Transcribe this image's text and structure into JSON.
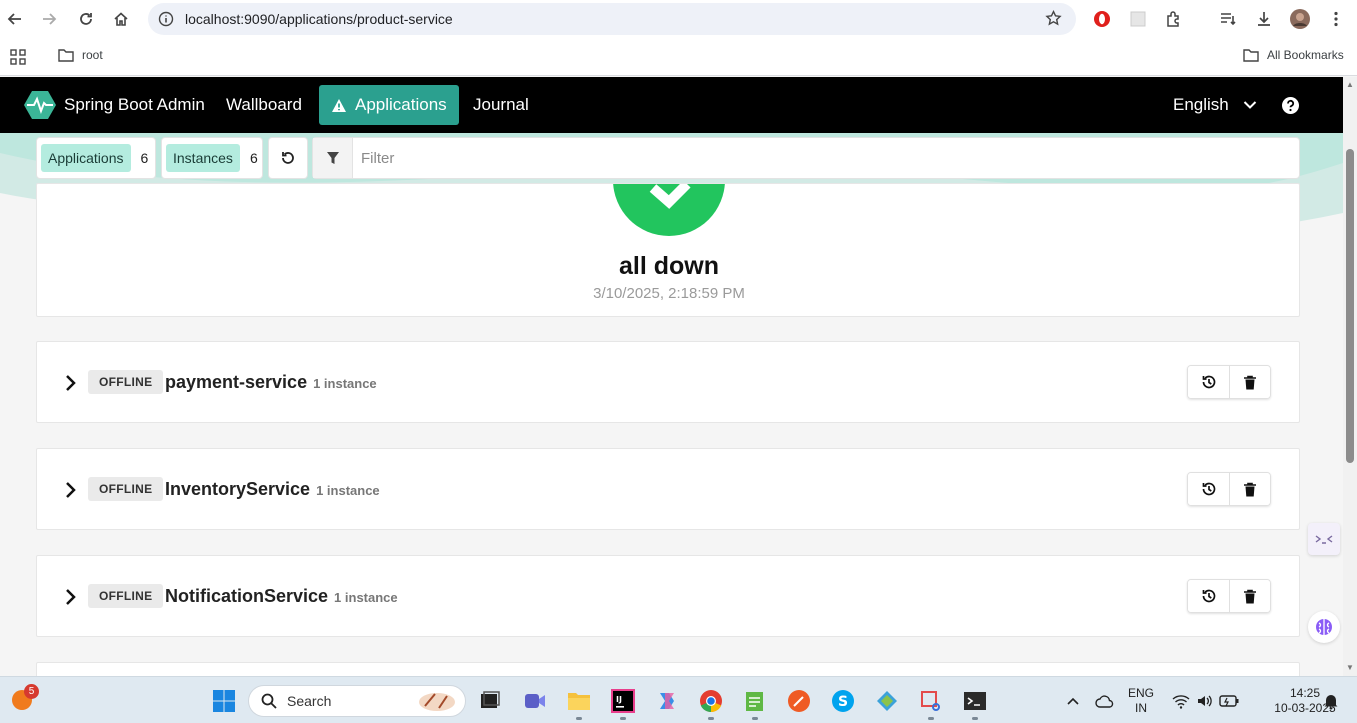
{
  "browser": {
    "url": "localhost:9090/applications/product-service",
    "bookmarks": [
      {
        "label": "root",
        "icon": "folder-icon"
      },
      {
        "label": "All Bookmarks",
        "icon": "folder-icon"
      }
    ]
  },
  "nav": {
    "brand": "Spring Boot Admin",
    "links": [
      {
        "label": "Wallboard",
        "active": false
      },
      {
        "label": "Applications",
        "active": true,
        "icon": "warning-icon"
      },
      {
        "label": "Journal",
        "active": false
      }
    ],
    "language": "English",
    "help_icon": "help-icon"
  },
  "filterbar": {
    "applications_label": "Applications",
    "applications_count": "6",
    "instances_label": "Instances",
    "instances_count": "6",
    "filter_placeholder": "Filter"
  },
  "status": {
    "title": "all down",
    "timestamp": "3/10/2025, 2:18:59 PM",
    "color": "#22c55e"
  },
  "applications": [
    {
      "status": "OFFLINE",
      "name": "payment-service",
      "instances": "1 instance"
    },
    {
      "status": "OFFLINE",
      "name": "InventoryService",
      "instances": "1 instance"
    },
    {
      "status": "OFFLINE",
      "name": "NotificationService",
      "instances": "1 instance"
    }
  ],
  "taskbar": {
    "notification_count": "5",
    "search_placeholder": "Search",
    "language_line1": "ENG",
    "language_line2": "IN",
    "time": "14:25",
    "date": "10-03-2025"
  },
  "colors": {
    "accent": "#2ba08f",
    "tag_bg": "#b4ecdf",
    "nav_bg": "#000000"
  }
}
